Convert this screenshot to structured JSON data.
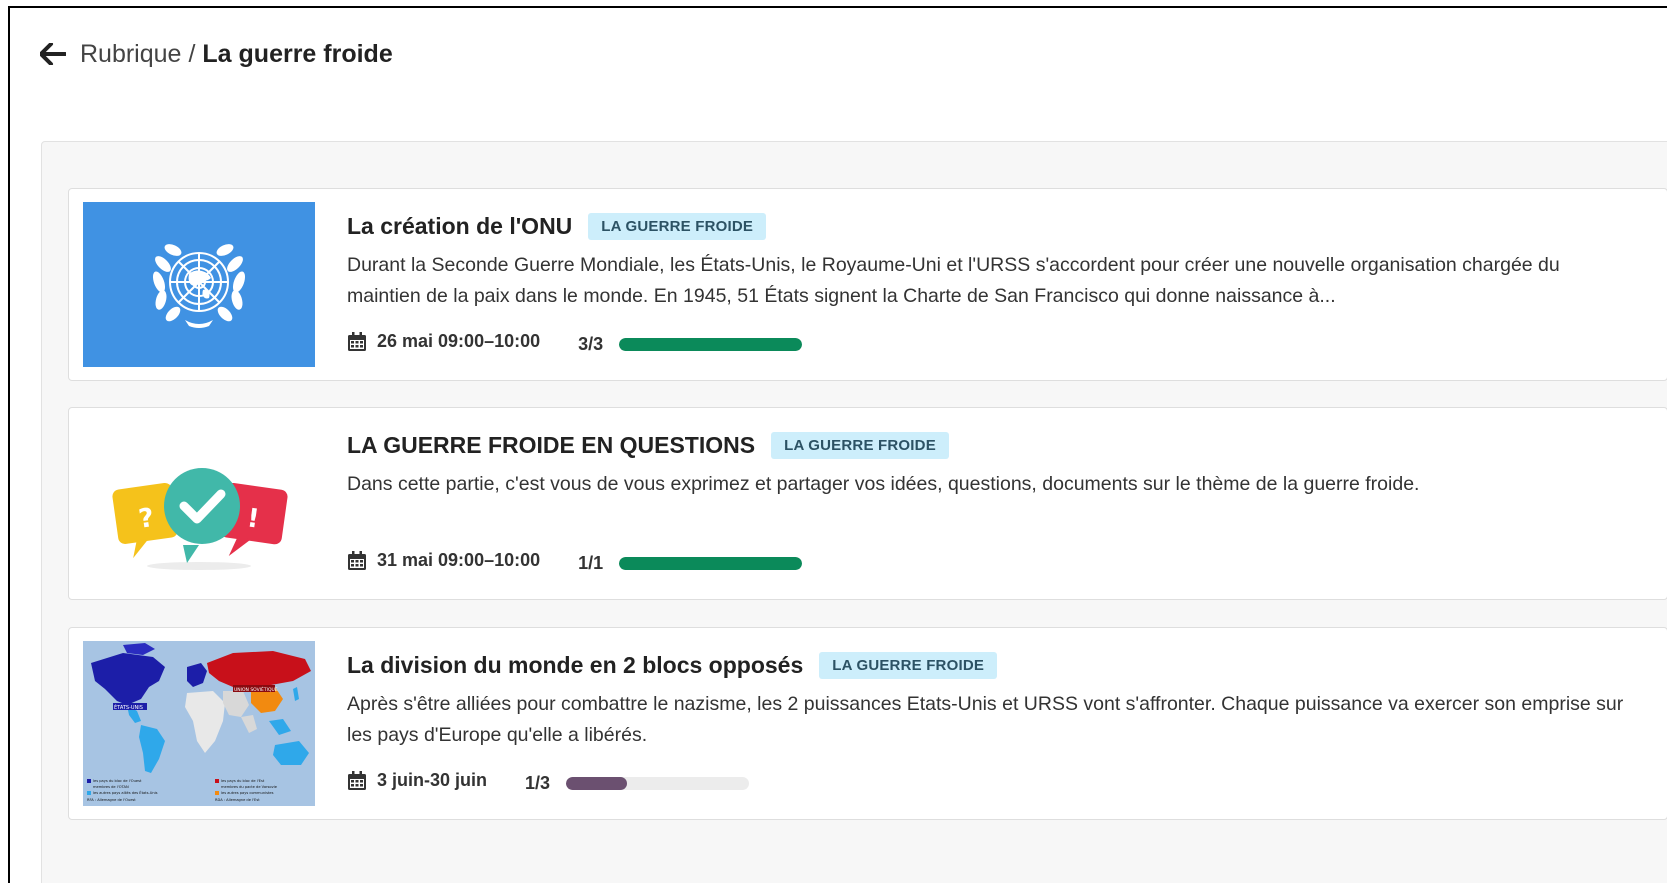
{
  "header": {
    "breadcrumb_parent": "Rubrique",
    "breadcrumb_separator": "/",
    "breadcrumb_current": "La guerre froide",
    "back_icon": "arrow-left-icon"
  },
  "colors": {
    "tag_bg": "#cdeefb",
    "progress_complete": "#0b8a5a",
    "progress_partial": "#6b5070",
    "progress_track": "#ececec"
  },
  "cards": [
    {
      "title": "La création de l'ONU",
      "tag": "LA GUERRE FROIDE",
      "description": "Durant la Seconde Guerre Mondiale, les États-Unis, le Royaume-Uni et l'URSS s'accordent pour créer une nouvelle organisation chargée du maintien de la paix dans le monde. En 1945, 51 États signent la Charte de San Francisco qui donne naissance à...",
      "date": "26 mai 09:00–10:00",
      "count": "3/3",
      "progress": 1.0,
      "thumbnail": "un-emblem"
    },
    {
      "title": "LA GUERRE FROIDE EN QUESTIONS",
      "tag": "LA GUERRE FROIDE",
      "description": "Dans cette partie, c'est vous de vous exprimez et partager vos idées, questions, documents sur le thème de la guerre froide.",
      "date": "31 mai 09:00–10:00",
      "count": "1/1",
      "progress": 1.0,
      "thumbnail": "speech-bubbles"
    },
    {
      "title": "La division du monde en 2 blocs opposés",
      "tag": "LA GUERRE FROIDE",
      "description": "Après s'être alliées pour combattre le nazisme, les 2 puissances Etats-Unis et URSS vont s'affronter. Chaque puissance va exercer son emprise sur les pays d'Europe qu'elle a libérés.",
      "date": "3 juin-30 juin",
      "count": "1/3",
      "progress": 0.333,
      "thumbnail": "world-map",
      "map_labels": {
        "usa": "ÉTATS-UNIS",
        "ussr": "UNION SOVIÉTIQUE",
        "legend_west_1": "les pays du bloc de l'Ouest",
        "legend_west_2": "membres de l'OTAN",
        "legend_west_3": "les autres pays alliés des États-Unis",
        "legend_west_4": "RFA : Allemagne de l'Ouest",
        "legend_east_1": "les pays du bloc de l'Est",
        "legend_east_2": "membres du pacte de Varsovie",
        "legend_east_3": "les autres pays communistes",
        "legend_east_4": "RDA : Allemagne de l'Est"
      }
    }
  ]
}
